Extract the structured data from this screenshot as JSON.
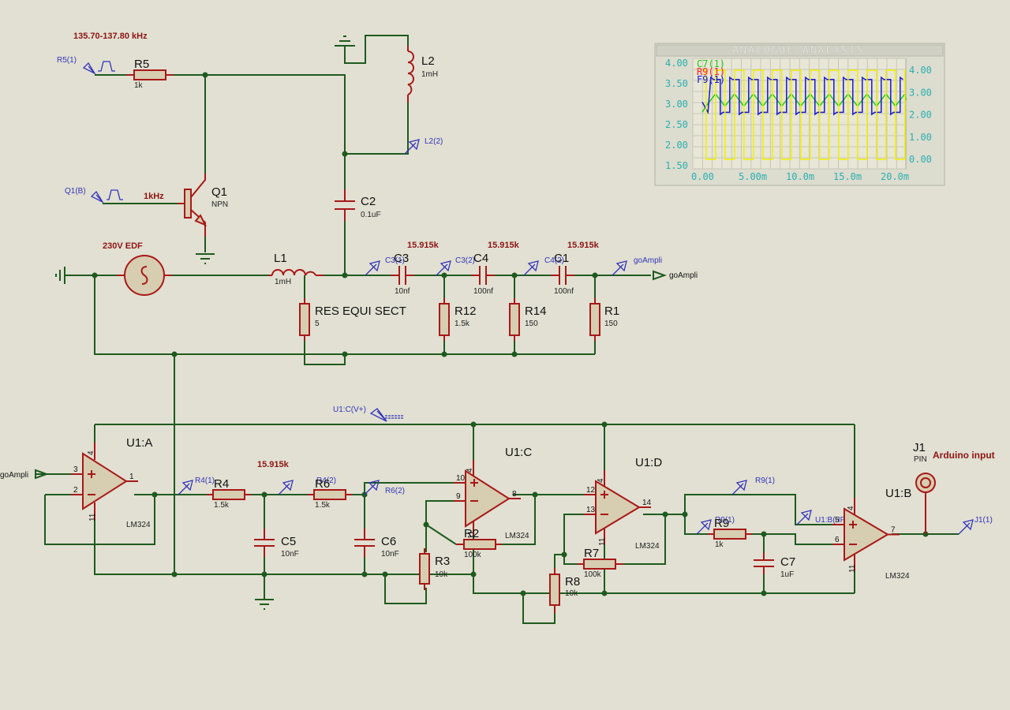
{
  "notes": {
    "freq_range": "135.70-137.80 kHz",
    "q1_freq": "1kHz",
    "source": "230V EDF",
    "c3_f": "15.915k",
    "c4_f": "15.915k",
    "c1_f": "15.915k",
    "r4_f": "15.915k"
  },
  "components": {
    "R5": {
      "ref": "R5",
      "value": "1k"
    },
    "L2": {
      "ref": "L2",
      "value": "1mH"
    },
    "Q1": {
      "ref": "Q1",
      "value": "NPN"
    },
    "C2": {
      "ref": "C2",
      "value": "0.1uF"
    },
    "L1": {
      "ref": "L1",
      "value": "1mH"
    },
    "C3": {
      "ref": "C3",
      "value": "10nf"
    },
    "C4": {
      "ref": "C4",
      "value": "100nf"
    },
    "C1": {
      "ref": "C1",
      "value": "100nf"
    },
    "RES": {
      "ref": "RES EQUI SECT",
      "value": "5"
    },
    "R12": {
      "ref": "R12",
      "value": "1.5k"
    },
    "R14": {
      "ref": "R14",
      "value": "150"
    },
    "R1": {
      "ref": "R1",
      "value": "150"
    },
    "U1A": {
      "ref": "U1:A",
      "value": "LM324"
    },
    "U1C": {
      "ref": "U1:C",
      "value": "LM324"
    },
    "U1D": {
      "ref": "U1:D",
      "value": "LM324"
    },
    "U1B": {
      "ref": "U1:B",
      "value": "LM324"
    },
    "R4": {
      "ref": "R4",
      "value": "1.5k"
    },
    "R6": {
      "ref": "R6",
      "value": "1.5k"
    },
    "C5": {
      "ref": "C5",
      "value": "10nF"
    },
    "C6": {
      "ref": "C6",
      "value": "10nF"
    },
    "R3": {
      "ref": "R3",
      "value": "10k"
    },
    "R2": {
      "ref": "R2",
      "value": "100k"
    },
    "R7": {
      "ref": "R7",
      "value": "100k"
    },
    "R8": {
      "ref": "R8",
      "value": "10k"
    },
    "R9": {
      "ref": "R9",
      "value": "1k"
    },
    "C7": {
      "ref": "C7",
      "value": "1uF"
    },
    "J1": {
      "ref": "J1",
      "value": "PIN",
      "note": "Arduino input"
    }
  },
  "probes": {
    "r5": "R5(1)",
    "q1": "Q1(B)",
    "l2": "L2(2)",
    "c3": "C3(1)",
    "c3b": "C3(2)",
    "c4": "C4(2)",
    "go": "goAmpli",
    "r41": "R4(1)",
    "r42": "R4(2)",
    "r62": "R6(2)",
    "vplus": "U1:C(V+)",
    "r91": "R9(1)",
    "r91b": "R9(1)",
    "u1b": "U1:B(-IP)",
    "j1": "J1(1)"
  },
  "terminals": {
    "go_out": "goAmpli",
    "go_in": "goAmpli"
  },
  "pins": {
    "a3": "3",
    "a2": "2",
    "a1": "1",
    "a4": "4",
    "a11": "11",
    "c10": "10",
    "c9": "9",
    "c8": "8",
    "c4": "4",
    "c11": "11",
    "d12": "12",
    "d13": "13",
    "d14": "14",
    "d4": "4",
    "d11": "11",
    "b5": "5",
    "b6": "6",
    "b7": "7",
    "b4": "4",
    "b11": "11"
  },
  "chart_data": {
    "type": "line",
    "title": "ANALOGUE ANALYSIS",
    "xlabel": "",
    "ylabel": "",
    "x_ticks": [
      "0.00",
      "5.00m",
      "10.0m",
      "15.0m",
      "20.0m"
    ],
    "y_left_ticks": [
      "1.50",
      "2.00",
      "2.50",
      "3.00",
      "3.50",
      "4.00"
    ],
    "y_right_ticks": [
      "0.00",
      "1.00",
      "2.00",
      "3.00",
      "4.00"
    ],
    "xlim": [
      0,
      0.0215
    ],
    "ylim_left": [
      1.5,
      4.0
    ],
    "ylim_right": [
      0,
      4.0
    ],
    "series": [
      {
        "name": "C7(1)",
        "color": "#22cc22",
        "axis": "left",
        "shape": "triangle",
        "low": 2.95,
        "high": 3.25,
        "period": 0.002
      },
      {
        "name": "R9(1)",
        "color": "#ff2020",
        "axis": "left",
        "shape": "hidden"
      },
      {
        "name": "F9(1)",
        "color": "#1a1acc",
        "axis": "left",
        "shape": "pulse",
        "low": 2.8,
        "high": 3.6,
        "period": 0.002
      },
      {
        "name": "",
        "color": "#f0f000",
        "axis": "right",
        "shape": "square",
        "low": 0,
        "high": 4.0,
        "period": 0.002
      }
    ],
    "grid": true
  },
  "colors": {
    "wire": "#1f5a1f",
    "pin": "#a81818",
    "probe": "#3333bb",
    "background": "#e1e0d2"
  }
}
